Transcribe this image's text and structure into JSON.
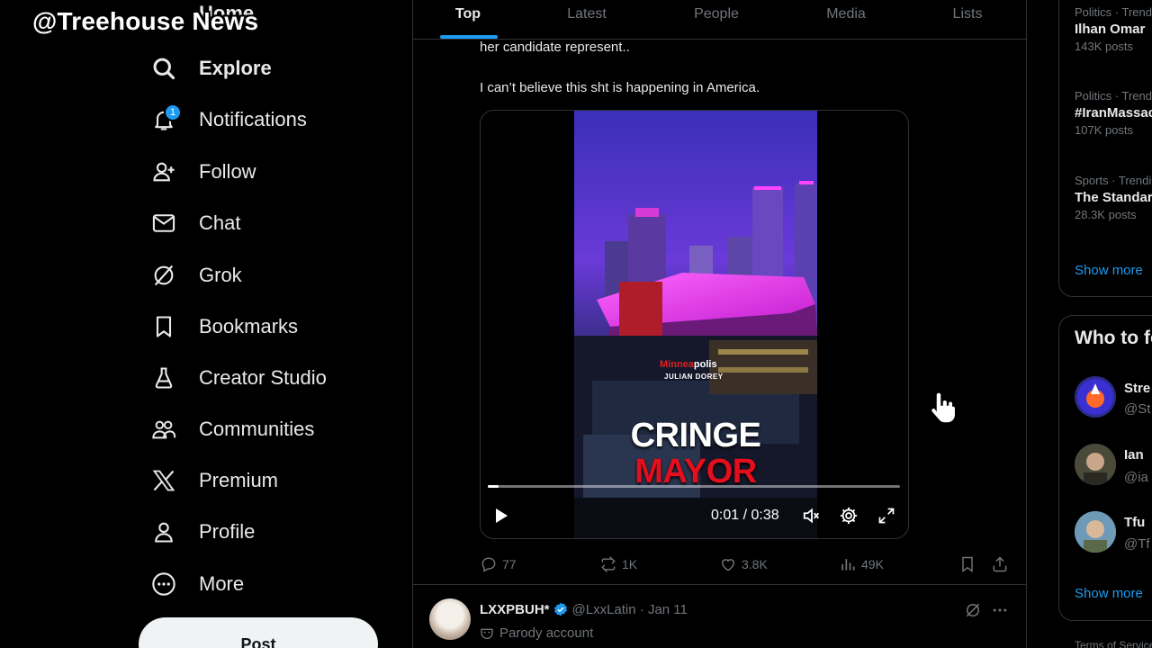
{
  "watermark": "@Treehouse News",
  "nav": {
    "home_peek": "Home",
    "items": [
      {
        "label": "Explore",
        "icon": "search-icon",
        "bold": true
      },
      {
        "label": "Notifications",
        "icon": "bell-icon",
        "badge": "1"
      },
      {
        "label": "Follow",
        "icon": "follow-icon"
      },
      {
        "label": "Chat",
        "icon": "envelope-icon"
      },
      {
        "label": "Grok",
        "icon": "grok-icon"
      },
      {
        "label": "Bookmarks",
        "icon": "bookmark-icon"
      },
      {
        "label": "Creator Studio",
        "icon": "flask-icon"
      },
      {
        "label": "Communities",
        "icon": "communities-icon"
      },
      {
        "label": "Premium",
        "icon": "x-logo-icon"
      },
      {
        "label": "Profile",
        "icon": "person-icon"
      },
      {
        "label": "More",
        "icon": "more-circle-icon"
      }
    ],
    "post_button": "Post"
  },
  "tabs": [
    "Top",
    "Latest",
    "People",
    "Media",
    "Lists"
  ],
  "active_tab": "Top",
  "tweet": {
    "text_line1": "her candidate represent..",
    "text_line2": "I can’t believe this sht is happening in America.",
    "video": {
      "brand_red": "Minnea",
      "brand_white": "polis",
      "sub": "JULIAN DOREY",
      "title_line1": "CRINGE",
      "title_line2": "MAYOR",
      "time": "0:01 / 0:38",
      "progress": 0.026
    },
    "actions": {
      "replies": "77",
      "reposts": "1K",
      "likes": "3.8K",
      "views": "49K"
    }
  },
  "tweet2": {
    "name": "LXXPBUH*",
    "handle": "@LxxLatin · Jan 11",
    "parody": "Parody account"
  },
  "right": {
    "trends": [
      {
        "meta": "Politics · Trending",
        "name": "Ilhan Omar",
        "count": "143K posts"
      },
      {
        "meta": "Politics · Trending",
        "name": "#IranMassacre",
        "count": "107K posts"
      },
      {
        "meta": "Sports · Trending",
        "name": "The Standard",
        "count": "28.3K posts"
      }
    ],
    "show_more": "Show more",
    "who_title": "Who to follow",
    "who": [
      {
        "name": "Stre",
        "handle": "@St"
      },
      {
        "name": "Ian",
        "handle": "@ia"
      },
      {
        "name": "Tfu",
        "handle": "@Tf"
      }
    ],
    "show_more2": "Show more",
    "tos": "Terms of Service"
  },
  "colors": {
    "accent": "#1d9bf0",
    "text": "#e7e9ea",
    "muted": "#71767b",
    "border": "#2f3336",
    "video_red": "#e40e1d"
  }
}
